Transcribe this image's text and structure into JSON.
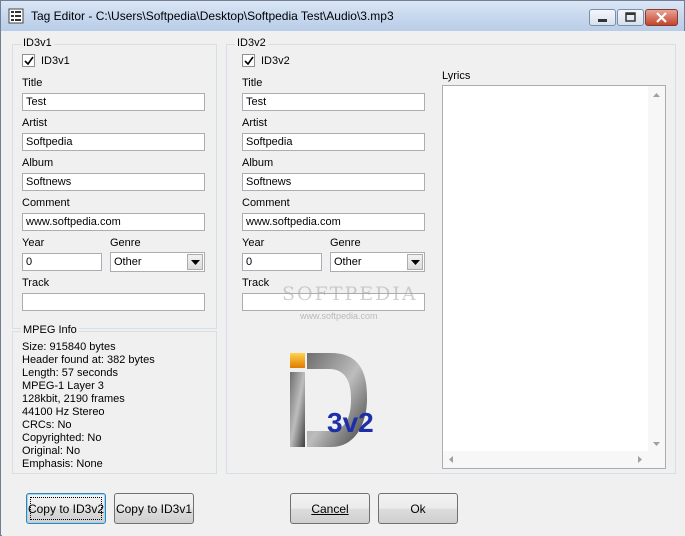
{
  "window": {
    "title": "Tag Editor - C:\\Users\\Softpedia\\Desktop\\Softpedia Test\\Audio\\3.mp3"
  },
  "id3v1": {
    "group_label": "ID3v1",
    "checkbox_label": "ID3v1",
    "checked": true,
    "title_label": "Title",
    "title_value": "Test",
    "artist_label": "Artist",
    "artist_value": "Softpedia",
    "album_label": "Album",
    "album_value": "Softnews",
    "comment_label": "Comment",
    "comment_value": "www.softpedia.com",
    "year_label": "Year",
    "year_value": "0",
    "genre_label": "Genre",
    "genre_value": "Other",
    "track_label": "Track",
    "track_value": ""
  },
  "id3v2": {
    "group_label": "ID3v2",
    "checkbox_label": "ID3v2",
    "checked": true,
    "title_label": "Title",
    "title_value": "Test",
    "artist_label": "Artist",
    "artist_value": "Softpedia",
    "album_label": "Album",
    "album_value": "Softnews",
    "comment_label": "Comment",
    "comment_value": "www.softpedia.com",
    "year_label": "Year",
    "year_value": "0",
    "genre_label": "Genre",
    "genre_value": "Other",
    "track_label": "Track",
    "track_value": "",
    "lyrics_label": "Lyrics",
    "logo_text": "3v2"
  },
  "mpeg_info": {
    "group_label": "MPEG Info",
    "lines": [
      "Size: 915840 bytes",
      "Header found at: 382 bytes",
      "Length: 57 seconds",
      "MPEG-1 Layer 3",
      "128kbit, 2190 frames",
      "44100 Hz Stereo",
      "CRCs: No",
      "Copyrighted: No",
      "Original: No",
      "Emphasis: None"
    ]
  },
  "buttons": {
    "copy_to_id3v2": "Copy to ID3v2",
    "copy_to_id3v1": "Copy to ID3v1",
    "cancel": "Cancel",
    "ok": "Ok"
  },
  "watermark": {
    "text": "SOFTPEDIA",
    "url": "www.softpedia.com"
  },
  "colors": {
    "accent": "#1c2fa8",
    "logo_orange": "#f5a623",
    "frame": "#d5dfe5"
  }
}
